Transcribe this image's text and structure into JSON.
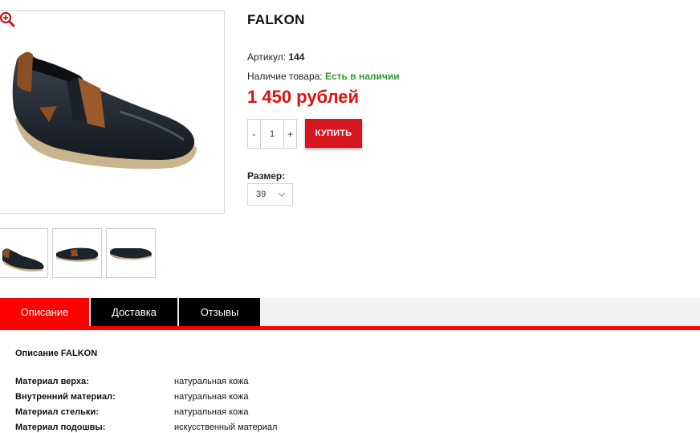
{
  "product": {
    "title": "FALKON",
    "sku_label": "Артикул:",
    "sku_value": "144",
    "stock_label": "Наличие товара:",
    "stock_value": "Есть в наличии",
    "price": "1 450 рублей"
  },
  "purchase": {
    "minus": "-",
    "quantity": "1",
    "plus": "+",
    "buy_label": "КУПИТЬ"
  },
  "size": {
    "label": "Размер:",
    "selected": "39"
  },
  "gallery": {
    "zoom_icon": "zoom-in-icon",
    "thumbnail_count": 3
  },
  "tabs": [
    {
      "label": "Описание",
      "active": true
    },
    {
      "label": "Доставка",
      "active": false
    },
    {
      "label": "Отзывы",
      "active": false
    }
  ],
  "description": {
    "title": "Описание FALKON",
    "specs": [
      {
        "key": "Материал верха:",
        "value": "натуральная кожа"
      },
      {
        "key": "Внутренний материал:",
        "value": "натуральная кожа"
      },
      {
        "key": "Материал стельки:",
        "value": "натуральная кожа"
      },
      {
        "key": "Материал подошвы:",
        "value": "искусственный материал"
      }
    ]
  },
  "colors": {
    "accent_red": "#ff0000",
    "price_red": "#e01010",
    "buy_button": "#d6161e",
    "in_stock_green": "#2e9a2e",
    "tab_inactive": "#000000"
  }
}
